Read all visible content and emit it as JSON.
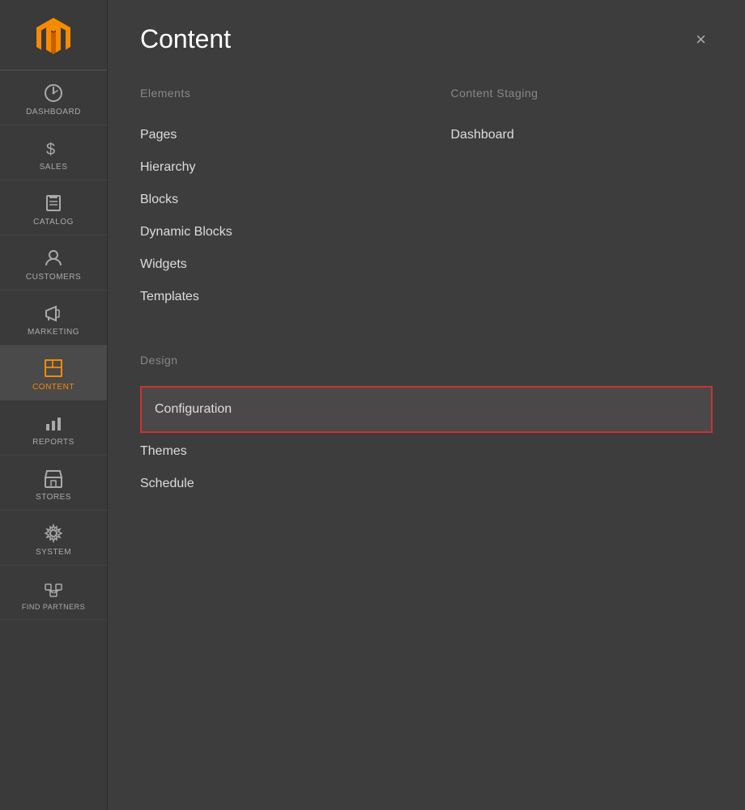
{
  "sidebar": {
    "logo_alt": "Magento Logo",
    "items": [
      {
        "id": "dashboard",
        "label": "DASHBOARD",
        "icon": "dashboard"
      },
      {
        "id": "sales",
        "label": "SALES",
        "icon": "sales"
      },
      {
        "id": "catalog",
        "label": "CATALOG",
        "icon": "catalog"
      },
      {
        "id": "customers",
        "label": "CUSTOMERS",
        "icon": "customers"
      },
      {
        "id": "marketing",
        "label": "MARKETING",
        "icon": "marketing"
      },
      {
        "id": "content",
        "label": "CONTENT",
        "icon": "content",
        "active": true
      },
      {
        "id": "reports",
        "label": "REPORTS",
        "icon": "reports"
      },
      {
        "id": "stores",
        "label": "STORES",
        "icon": "stores"
      },
      {
        "id": "system",
        "label": "SYSTEM",
        "icon": "system"
      },
      {
        "id": "find-partners",
        "label": "FIND PARTNERS",
        "icon": "partners"
      }
    ]
  },
  "panel": {
    "title": "Content",
    "close_label": "×",
    "sections": {
      "elements": {
        "title": "Elements",
        "items": [
          {
            "id": "pages",
            "label": "Pages"
          },
          {
            "id": "hierarchy",
            "label": "Hierarchy"
          },
          {
            "id": "blocks",
            "label": "Blocks"
          },
          {
            "id": "dynamic-blocks",
            "label": "Dynamic Blocks"
          },
          {
            "id": "widgets",
            "label": "Widgets"
          },
          {
            "id": "templates",
            "label": "Templates"
          }
        ]
      },
      "content_staging": {
        "title": "Content Staging",
        "items": [
          {
            "id": "dashboard",
            "label": "Dashboard"
          }
        ]
      },
      "design": {
        "title": "Design",
        "items": [
          {
            "id": "configuration",
            "label": "Configuration",
            "highlighted": true
          },
          {
            "id": "themes",
            "label": "Themes"
          },
          {
            "id": "schedule",
            "label": "Schedule"
          }
        ]
      }
    }
  }
}
